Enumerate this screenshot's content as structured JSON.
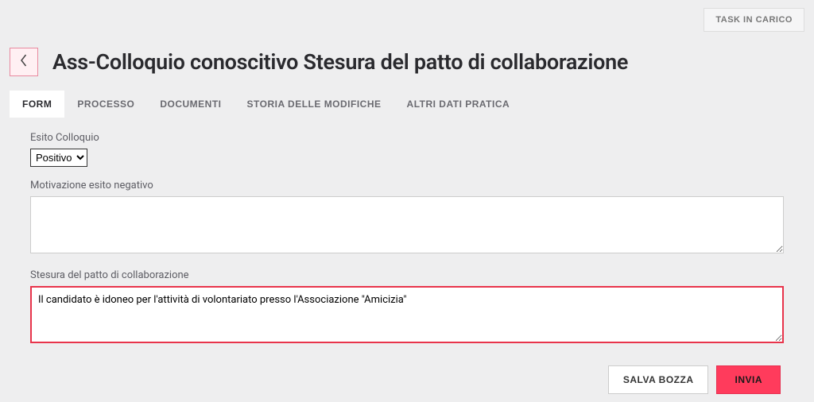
{
  "topbar": {
    "task_in_carico": "TASK IN CARICO"
  },
  "header": {
    "title": "Ass-Colloquio conoscitivo Stesura del patto di collaborazione"
  },
  "tabs": [
    {
      "label": "FORM",
      "active": true
    },
    {
      "label": "PROCESSO",
      "active": false
    },
    {
      "label": "DOCUMENTI",
      "active": false
    },
    {
      "label": "STORIA DELLE MODIFICHE",
      "active": false
    },
    {
      "label": "ALTRI DATI PRATICA",
      "active": false
    }
  ],
  "form": {
    "esito_label": "Esito Colloquio",
    "esito_value": "Positivo",
    "motivazione_label": "Motivazione esito negativo",
    "motivazione_value": "",
    "stesura_label": "Stesura del patto di collaborazione",
    "stesura_value": "Il candidato è idoneo per l'attività di volontariato presso l'Associazione \"Amicizia\""
  },
  "actions": {
    "salva_bozza": "SALVA BOZZA",
    "invia": "INVIA"
  }
}
